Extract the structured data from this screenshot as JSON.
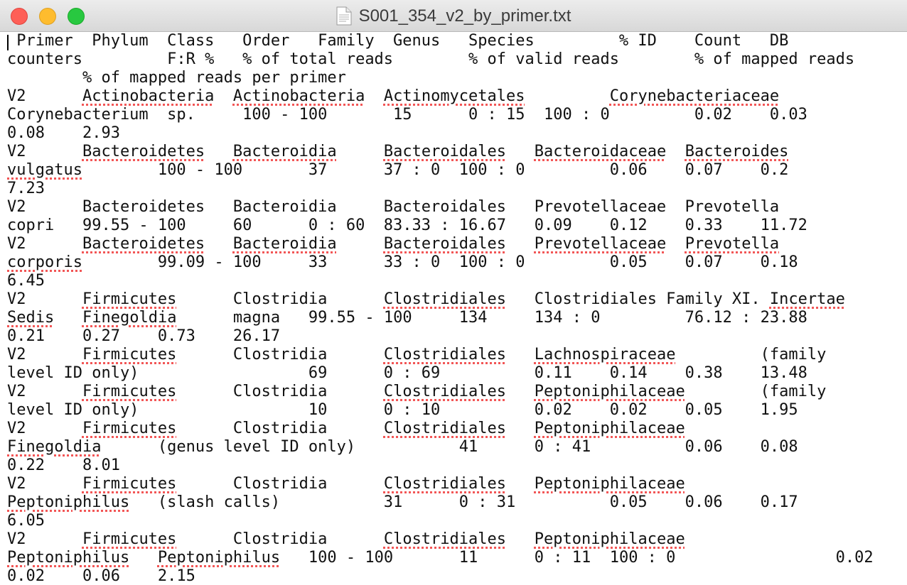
{
  "window": {
    "title": "S001_354_v2_by_primer.txt"
  },
  "icons": {
    "close": "close-button",
    "minimize": "minimize-button",
    "zoom": "zoom-button",
    "document": "document-icon"
  },
  "colors": {
    "spellcheck_underline": "#f25656",
    "close": "#fe5f57",
    "minimize": "#febc2e",
    "zoom": "#28c840"
  },
  "lines": [
    [
      {
        "t": " Primer  Phylum  Class   Order   Family  Genus   Species         % ID    Count   DB"
      }
    ],
    [
      {
        "t": "counters         F:R %   % of total reads        % of valid reads        % of mapped reads"
      }
    ],
    [
      {
        "t": "        % of mapped reads per primer"
      }
    ],
    [
      {
        "t": "V2      "
      },
      {
        "t": "Actinobacteria",
        "sp": true
      },
      {
        "t": "  "
      },
      {
        "t": "Actinobacteria",
        "sp": true
      },
      {
        "t": "  "
      },
      {
        "t": "Actinomycetales",
        "sp": true
      },
      {
        "t": "         "
      },
      {
        "t": "Corynebacteriaceae",
        "sp": true
      }
    ],
    [
      {
        "t": "Corynebacterium  sp.     100 - 100       15      0 : 15  100 : 0         0.02    0.03"
      }
    ],
    [
      {
        "t": "0.08    2.93"
      }
    ],
    [
      {
        "t": "V2      "
      },
      {
        "t": "Bacteroidetes",
        "sp": true
      },
      {
        "t": "   "
      },
      {
        "t": "Bacteroidia",
        "sp": true
      },
      {
        "t": "     "
      },
      {
        "t": "Bacteroidales",
        "sp": true
      },
      {
        "t": "   "
      },
      {
        "t": "Bacteroidaceae",
        "sp": true
      },
      {
        "t": "  "
      },
      {
        "t": "Bacteroides",
        "sp": true
      }
    ],
    [
      {
        "t": "vulgatus",
        "sp": true
      },
      {
        "t": "        100 - 100       37      37 : 0  100 : 0         0.06    0.07    0.2"
      }
    ],
    [
      {
        "t": "7.23"
      }
    ],
    [
      {
        "t": "V2      Bacteroidetes   Bacteroidia     Bacteroidales   Prevotellaceae  Prevotella"
      }
    ],
    [
      {
        "t": "copri   99.55 - 100     60      0 : 60  83.33 : 16.67   0.09    0.12    0.33    11.72"
      }
    ],
    [
      {
        "t": "V2      "
      },
      {
        "t": "Bacteroidetes",
        "sp": true
      },
      {
        "t": "   "
      },
      {
        "t": "Bacteroidia",
        "sp": true
      },
      {
        "t": "     "
      },
      {
        "t": "Bacteroidales",
        "sp": true
      },
      {
        "t": "   "
      },
      {
        "t": "Prevotellaceae",
        "sp": true
      },
      {
        "t": "  "
      },
      {
        "t": "Prevotella",
        "sp": true
      }
    ],
    [
      {
        "t": "corporis",
        "sp": true
      },
      {
        "t": "        99.09 - 100     33      33 : 0  100 : 0         0.05    0.07    0.18"
      }
    ],
    [
      {
        "t": "6.45"
      }
    ],
    [
      {
        "t": "V2      "
      },
      {
        "t": "Firmicutes",
        "sp": true
      },
      {
        "t": "      Clostridia      "
      },
      {
        "t": "Clostridiales",
        "sp": true
      },
      {
        "t": "   Clostridiales Family XI. "
      },
      {
        "t": "Incertae",
        "sp": true
      }
    ],
    [
      {
        "t": "Sedis",
        "sp": true
      },
      {
        "t": "   "
      },
      {
        "t": "Finegoldia",
        "sp": true
      },
      {
        "t": "      magna   99.55 - 100     134     134 : 0         76.12 : 23.88"
      }
    ],
    [
      {
        "t": "0.21    0.27    0.73    26.17"
      }
    ],
    [
      {
        "t": "V2      "
      },
      {
        "t": "Firmicutes",
        "sp": true
      },
      {
        "t": "      Clostridia      "
      },
      {
        "t": "Clostridiales",
        "sp": true
      },
      {
        "t": "   "
      },
      {
        "t": "Lachnospiraceae",
        "sp": true
      },
      {
        "t": "         (family"
      }
    ],
    [
      {
        "t": "level ID only)                  69      0 : 69          0.11    0.14    0.38    13.48"
      }
    ],
    [
      {
        "t": "V2      "
      },
      {
        "t": "Firmicutes",
        "sp": true
      },
      {
        "t": "      Clostridia      "
      },
      {
        "t": "Clostridiales",
        "sp": true
      },
      {
        "t": "   "
      },
      {
        "t": "Peptoniphilaceae",
        "sp": true
      },
      {
        "t": "        (family"
      }
    ],
    [
      {
        "t": "level ID only)                  10      0 : 10          0.02    0.02    0.05    1.95"
      }
    ],
    [
      {
        "t": "V2      "
      },
      {
        "t": "Firmicutes",
        "sp": true
      },
      {
        "t": "      Clostridia      "
      },
      {
        "t": "Clostridiales",
        "sp": true
      },
      {
        "t": "   "
      },
      {
        "t": "Peptoniphilaceae",
        "sp": true
      }
    ],
    [
      {
        "t": "Finegoldia",
        "sp": true
      },
      {
        "t": "      (genus level ID only)           41      0 : 41          0.06    0.08"
      }
    ],
    [
      {
        "t": "0.22    8.01"
      }
    ],
    [
      {
        "t": "V2      "
      },
      {
        "t": "Firmicutes",
        "sp": true
      },
      {
        "t": "      Clostridia      "
      },
      {
        "t": "Clostridiales",
        "sp": true
      },
      {
        "t": "   "
      },
      {
        "t": "Peptoniphilaceae",
        "sp": true
      }
    ],
    [
      {
        "t": "Peptoniphilus",
        "sp": true
      },
      {
        "t": "   (slash calls)           31      0 : 31          0.05    0.06    0.17"
      }
    ],
    [
      {
        "t": "6.05"
      }
    ],
    [
      {
        "t": "V2      "
      },
      {
        "t": "Firmicutes",
        "sp": true
      },
      {
        "t": "      Clostridia      "
      },
      {
        "t": "Clostridiales",
        "sp": true
      },
      {
        "t": "   "
      },
      {
        "t": "Peptoniphilaceae",
        "sp": true
      }
    ],
    [
      {
        "t": "Peptoniphilus",
        "sp": true
      },
      {
        "t": "   "
      },
      {
        "t": "Peptoniphilus",
        "sp": true
      },
      {
        "t": "   100 - 100       11      0 : 11  100 : 0                 0.02"
      }
    ],
    [
      {
        "t": "0.02    0.06    2.15"
      }
    ]
  ]
}
